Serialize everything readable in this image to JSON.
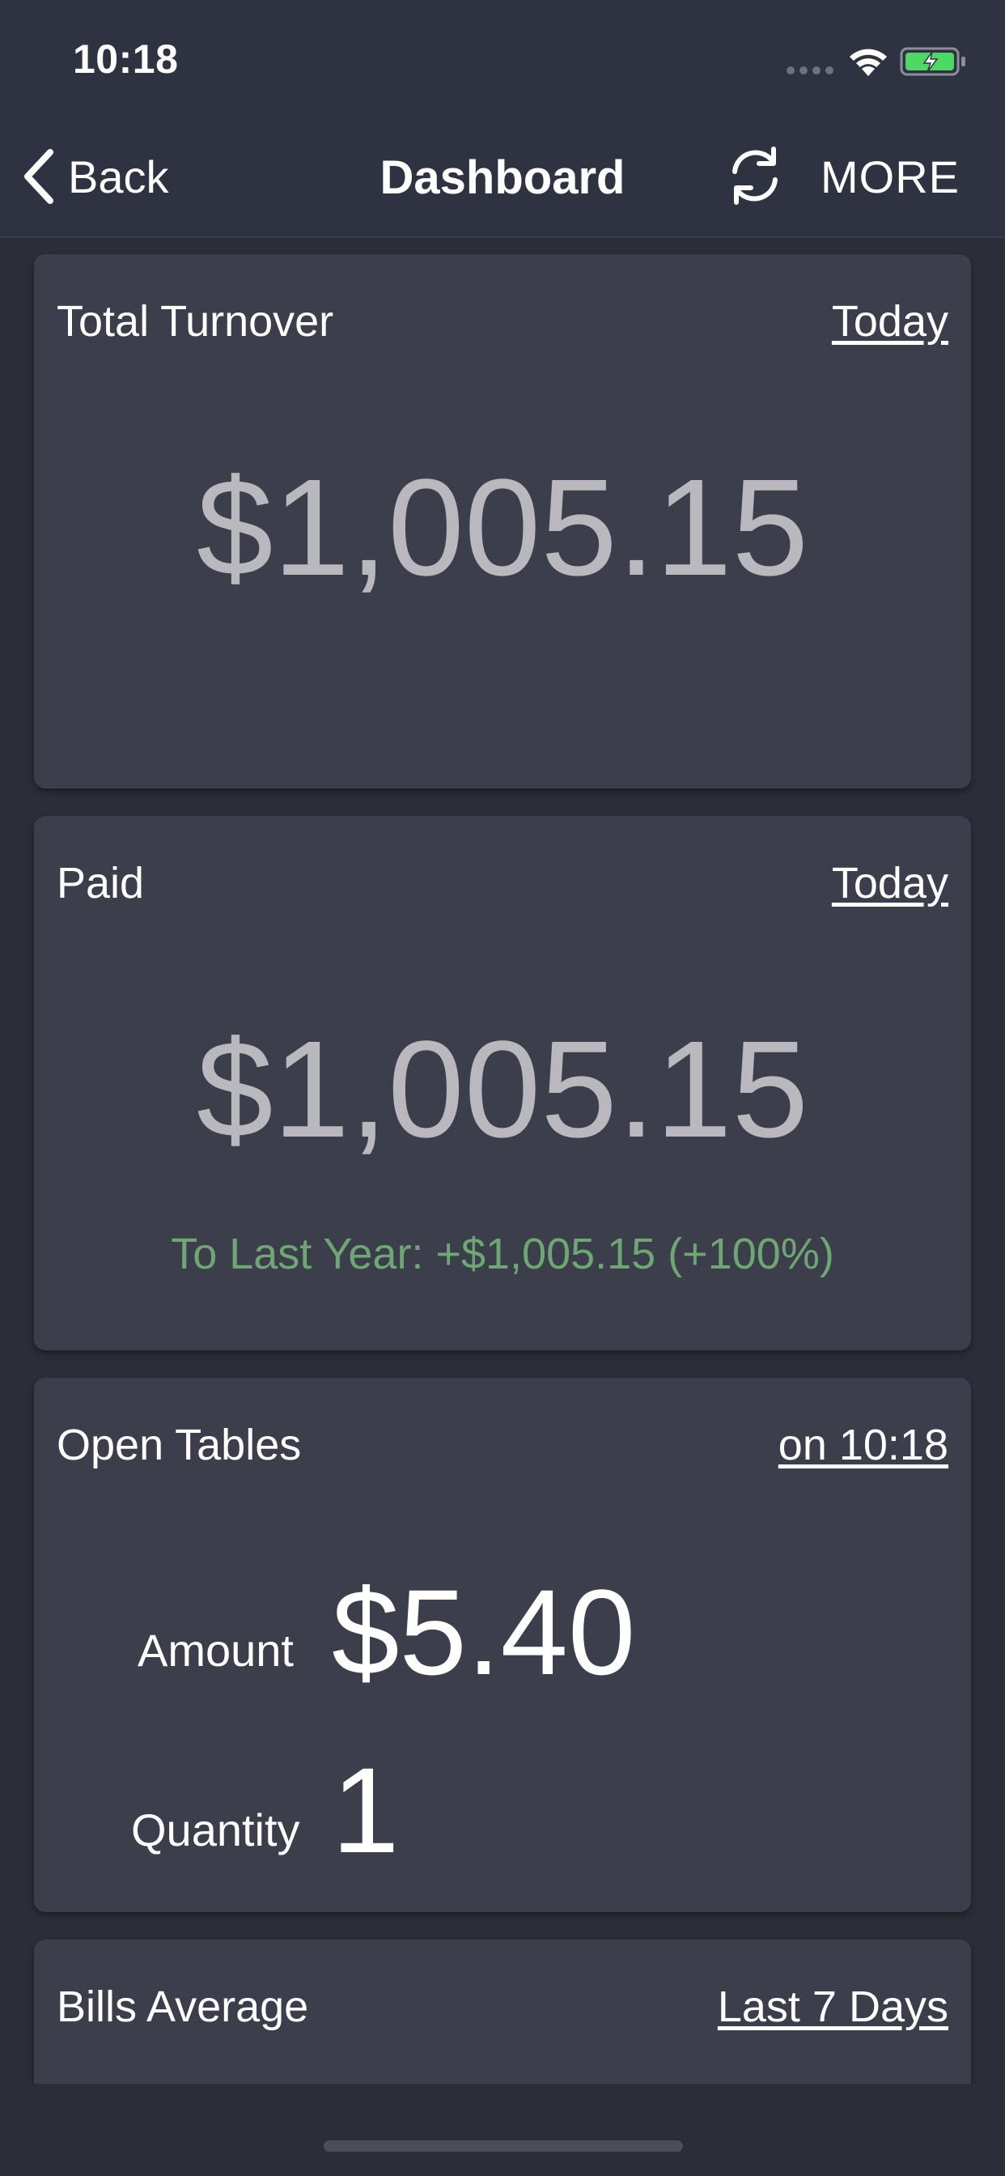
{
  "status_bar": {
    "time": "10:18",
    "icons": [
      "signal-dots-icon",
      "wifi-icon",
      "battery-charging-icon"
    ],
    "battery_color": "#4cd964"
  },
  "nav": {
    "back_label": "Back",
    "title": "Dashboard",
    "refresh_icon": "refresh-icon",
    "more_label": "MORE"
  },
  "cards": {
    "total_turnover": {
      "title": "Total Turnover",
      "period": "Today",
      "amount": "$1,005.15"
    },
    "paid": {
      "title": "Paid",
      "period": "Today",
      "amount": "$1,005.15",
      "comparison": "To Last Year: +$1,005.15 (+100%)",
      "comparison_color": "#6ea773"
    },
    "open_tables": {
      "title": "Open Tables",
      "period": "on 10:18",
      "amount_label": "Amount",
      "amount_value": "$5.40",
      "quantity_label": "Quantity",
      "quantity_value": "1"
    },
    "bills_average": {
      "title": "Bills Average",
      "period": "Last 7 Days"
    }
  },
  "colors": {
    "background": "#2b2e38",
    "card": "#3c3e4b",
    "amount_text": "#b8b8be"
  }
}
